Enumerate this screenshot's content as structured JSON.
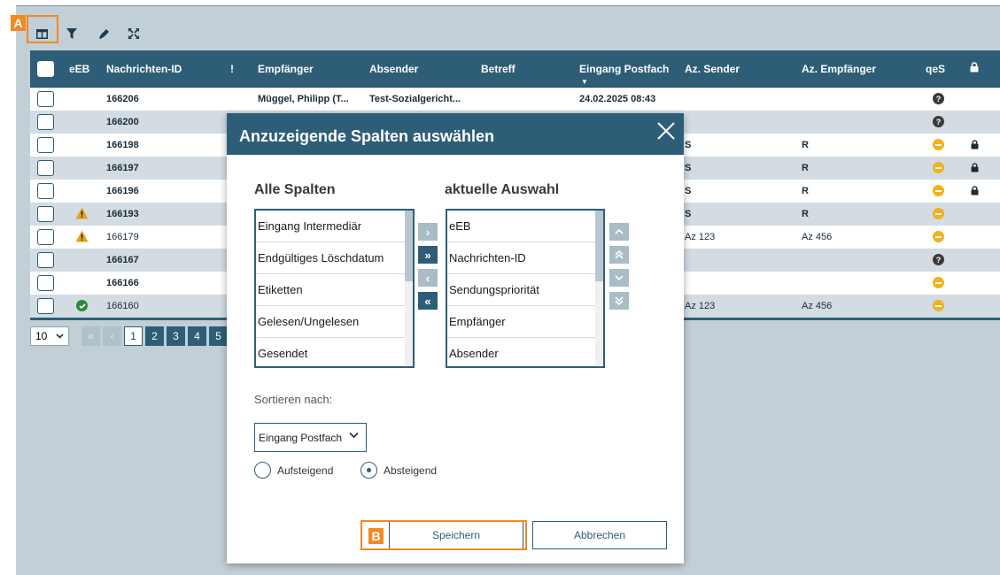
{
  "annotations": {
    "a_label": "A",
    "b_label": "B"
  },
  "toolbar": {
    "icons": [
      "columns-icon",
      "filter-icon",
      "highlighter-icon",
      "expand-icon"
    ]
  },
  "table": {
    "headers": {
      "eeb": "eEB",
      "nachrichten_id": "Nachrichten-ID",
      "priority": "!",
      "empfaenger": "Empfänger",
      "absender": "Absender",
      "betreff": "Betreff",
      "eingang_postfach": "Eingang Postfach",
      "az_sender": "Az. Sender",
      "az_empfaenger": "Az. Empfänger",
      "qes": "qeS"
    },
    "rows": [
      {
        "id": "166206",
        "empfaenger": "Müggel, Philipp (T...",
        "absender": "Test-Sozialgericht...",
        "eingang": "24.02.2025 08:43",
        "az_sender": "",
        "az_empf": "",
        "qes": "question",
        "lock": false,
        "eeb": "",
        "bold": true
      },
      {
        "id": "166200",
        "empfaenger": "",
        "absender": "",
        "eingang": "",
        "az_sender": "",
        "az_empf": "",
        "qes": "question",
        "lock": false,
        "eeb": "",
        "bold": true
      },
      {
        "id": "166198",
        "empfaenger": "",
        "absender": "",
        "eingang": "",
        "az_sender": "S",
        "az_empf": "R",
        "qes": "minus",
        "lock": true,
        "eeb": "",
        "bold": true
      },
      {
        "id": "166197",
        "empfaenger": "",
        "absender": "",
        "eingang": "",
        "az_sender": "S",
        "az_empf": "R",
        "qes": "minus",
        "lock": true,
        "eeb": "",
        "bold": true
      },
      {
        "id": "166196",
        "empfaenger": "",
        "absender": "",
        "eingang": "",
        "az_sender": "S",
        "az_empf": "R",
        "qes": "minus",
        "lock": true,
        "eeb": "",
        "bold": true
      },
      {
        "id": "166193",
        "empfaenger": "",
        "absender": "",
        "eingang": "",
        "az_sender": "S",
        "az_empf": "R",
        "qes": "minus",
        "lock": false,
        "eeb": "warning",
        "bold": true
      },
      {
        "id": "166179",
        "empfaenger": "",
        "absender": "",
        "eingang": "",
        "az_sender": "Az 123",
        "az_empf": "Az 456",
        "qes": "minus",
        "lock": false,
        "eeb": "warning",
        "bold": false
      },
      {
        "id": "166167",
        "empfaenger": "",
        "absender": "",
        "eingang": "",
        "az_sender": "",
        "az_empf": "",
        "qes": "question",
        "lock": false,
        "eeb": "",
        "bold": true
      },
      {
        "id": "166166",
        "empfaenger": "",
        "absender": "",
        "eingang": "",
        "az_sender": "",
        "az_empf": "",
        "qes": "minus",
        "lock": false,
        "eeb": "",
        "bold": true
      },
      {
        "id": "166160",
        "empfaenger": "",
        "absender": "",
        "eingang": "",
        "az_sender": "Az 123",
        "az_empf": "Az 456",
        "qes": "minus",
        "lock": false,
        "eeb": "ok",
        "bold": false
      }
    ]
  },
  "pager": {
    "page_size": "10",
    "pages": [
      "1",
      "2",
      "3",
      "4",
      "5"
    ]
  },
  "modal": {
    "title": "Anzuzeigende Spalten auswählen",
    "all_columns_title": "Alle Spalten",
    "current_title": "aktuelle Auswahl",
    "all_columns": [
      "Eingang Intermediär",
      "Endgültiges Löschdatum",
      "Etiketten",
      "Gelesen/Ungelesen",
      "Gesendet"
    ],
    "current": [
      "eEB",
      "Nachrichten-ID",
      "Sendungspriorität",
      "Empfänger",
      "Absender"
    ],
    "sort_label": "Sortieren nach:",
    "sort_value": "Eingang Postfach",
    "asc_label": "Aufsteigend",
    "desc_label": "Absteigend",
    "selected_order": "Absteigend",
    "save_label": "Speichern",
    "cancel_label": "Abbrechen"
  },
  "colors": {
    "primary": "#2e5e77",
    "highlight": "#f08a24",
    "warning": "#f0b21d",
    "success": "#2e8a3a"
  }
}
